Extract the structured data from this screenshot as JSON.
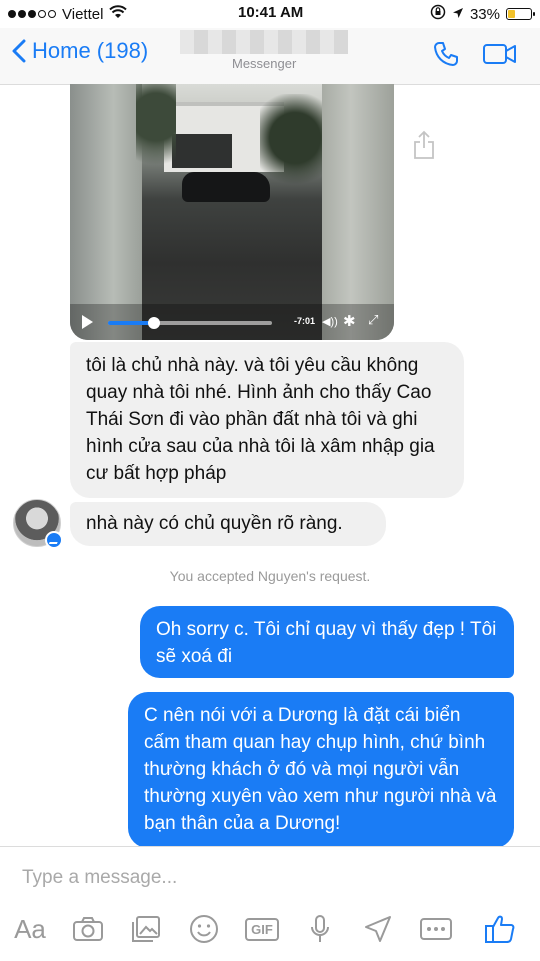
{
  "status_bar": {
    "carrier": "Viettel",
    "time": "10:41 AM",
    "battery_percent": "33%",
    "battery_level": 0.33,
    "signal_bars_filled": 3,
    "icons": [
      "wifi-icon",
      "rotation-lock-icon",
      "location-arrow-icon",
      "battery-icon"
    ]
  },
  "nav": {
    "back_label": "Home (198)",
    "subtitle": "Messenger",
    "icons": [
      "phone-icon",
      "video-call-icon"
    ]
  },
  "video": {
    "time_remaining": "-7:01",
    "progress": 0.28,
    "icons": [
      "play-icon",
      "volume-icon",
      "settings-gear-icon",
      "fullscreen-icon",
      "share-icon"
    ]
  },
  "messages": [
    {
      "direction": "incoming",
      "text": "tôi là chủ nhà này. và tôi yêu cầu không quay nhà tôi nhé. Hình ảnh cho thấy Cao Thái Sơn đi vào phần đất nhà tôi và ghi hình cửa sau của nhà tôi là xâm nhập gia cư bất hợp pháp"
    },
    {
      "direction": "incoming",
      "text": "nhà này có chủ quyền rõ ràng."
    },
    {
      "direction": "outgoing",
      "text": "Oh sorry c. Tôi chỉ quay vì thấy đẹp ! Tôi sẽ xoá đi"
    },
    {
      "direction": "outgoing",
      "text": "C nên nói với a Dương là đặt cái biển cấm tham quan hay chụp hình, chứ bình thường khách ở đó và mọi người vẫn thường xuyên vào xem như người nhà và bạn thân của a Dương!"
    }
  ],
  "system_message": "You accepted Nguyen's request.",
  "composer": {
    "placeholder": "Type a message...",
    "aa_label": "Aa",
    "gif_label": "GIF",
    "toolbar_icons": [
      "camera-icon",
      "gallery-icon",
      "sticker-icon",
      "gif-icon",
      "microphone-icon",
      "location-icon",
      "more-icon",
      "thumbs-up-icon"
    ]
  },
  "colors": {
    "accent": "#1a7cf5",
    "incoming_bubble": "#f0f0f0",
    "battery": "#f2c22b"
  }
}
